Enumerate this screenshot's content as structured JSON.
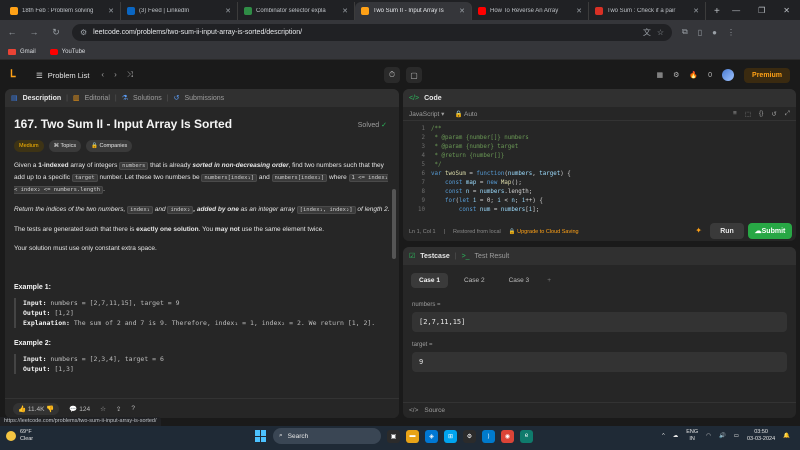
{
  "browser": {
    "tabs": [
      {
        "title": "18th Feb : Problem solving",
        "icon": "leetcode-icon",
        "color": "#ffa116",
        "active": false
      },
      {
        "title": "(3) Feed | LinkedIn",
        "icon": "linkedin-icon",
        "color": "#0a66c2",
        "active": false
      },
      {
        "title": "Combinator selector expla",
        "icon": "gfg-icon",
        "color": "#2f8d46",
        "active": false
      },
      {
        "title": "Two Sum II - Input Array Is",
        "icon": "leetcode-icon",
        "color": "#ffa116",
        "active": true
      },
      {
        "title": "How To Reverse An Array",
        "icon": "youtube-icon",
        "color": "#ff0000",
        "active": false
      },
      {
        "title": "Two Sum : Check if a pair",
        "icon": "takeuforward-icon",
        "color": "#d93025",
        "active": false
      }
    ],
    "url": "leetcode.com/problems/two-sum-ii-input-array-is-sorted/description/",
    "bookmarks": [
      "Gmail",
      "YouTube"
    ],
    "status_link": "https://leetcode.com/problems/two-sum-ii-input-array-is-sorted/"
  },
  "lcnav": {
    "problem_list": "Problem List",
    "coins": "0",
    "premium": "Premium"
  },
  "description": {
    "tabs": [
      "Description",
      "Editorial",
      "Solutions",
      "Submissions"
    ],
    "title": "167. Two Sum II - Input Array Is Sorted",
    "solved": "Solved",
    "difficulty": "Medium",
    "chips": [
      "Topics",
      "Companies"
    ],
    "p1_a": "Given a ",
    "p1_b": "1-indexed",
    "p1_c": " array of integers ",
    "p1_code1": "numbers",
    "p1_d": " that is already ",
    "p1_e": "sorted in non-decreasing order",
    "p1_f": ", find two numbers such that they add up to a specific ",
    "p1_code2": "target",
    "p1_g": " number. Let these two numbers be ",
    "p1_code3": "numbers[index₁]",
    "p1_h": " and ",
    "p1_code4": "numbers[index₂]",
    "p1_i": " where ",
    "p1_code5": "1 <= index₁ < index₂ <= numbers.length",
    "p1_j": ".",
    "p2_a": "Return the indices of the two numbers, ",
    "p2_code1": "index₁",
    "p2_b": " and ",
    "p2_code2": "index₂",
    "p2_c": ", added by one",
    "p2_d": " as an integer array ",
    "p2_code3": "[index₁, index₂]",
    "p2_e": " of length 2.",
    "p3_a": "The tests are generated such that there is ",
    "p3_b": "exactly one solution",
    "p3_c": ". You ",
    "p3_d": "may not",
    "p3_e": " use the same element twice.",
    "p4": "Your solution must use only constant extra space.",
    "ex1_title": "Example 1:",
    "ex1_input_label": "Input:",
    "ex1_input": " numbers = [2,7,11,15], target = 9",
    "ex1_output_label": "Output:",
    "ex1_output": " [1,2]",
    "ex1_expl_label": "Explanation:",
    "ex1_expl": " The sum of 2 and 7 is 9. Therefore, index₁ = 1, index₂ = 2. We return [1, 2].",
    "ex2_title": "Example 2:",
    "ex2_input_label": "Input:",
    "ex2_input": " numbers = [2,3,4], target = 6",
    "ex2_output_label": "Output:",
    "ex2_output": " [1,3]",
    "likes": "11.4K",
    "comments": "124"
  },
  "code": {
    "header": "Code",
    "language": "JavaScript",
    "mode": "Auto",
    "status_pos": "Ln 1, Col 1",
    "status_restored": "Restored from local",
    "upgrade": "Upgrade to Cloud Saving",
    "run": "Run",
    "submit": "Submit"
  },
  "testcase": {
    "tab_active": "Testcase",
    "tab_other": "Test Result",
    "cases": [
      "Case 1",
      "Case 2",
      "Case 3"
    ],
    "add": "+",
    "label1": "numbers =",
    "value1": "[2,7,11,15]",
    "label2": "target =",
    "value2": "9",
    "source": "Source"
  },
  "taskbar": {
    "temp": "69°F",
    "weather": "Clear",
    "search": "Search",
    "lang1": "ENG",
    "lang2": "IN",
    "time": "03:50",
    "date": "03-03-2024"
  }
}
